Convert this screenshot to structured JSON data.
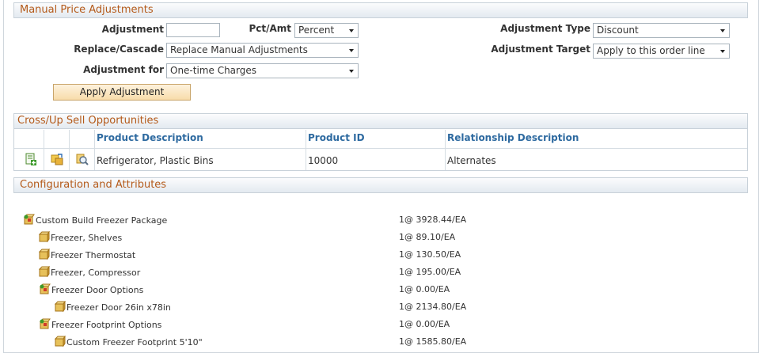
{
  "manual_price": {
    "header": "Manual Price Adjustments",
    "adjustment_label": "Adjustment",
    "adjustment_value": "",
    "pct_amt_label": "Pct/Amt",
    "pct_amt_value": "Percent",
    "adjustment_type_label": "Adjustment Type",
    "adjustment_type_value": "Discount",
    "replace_cascade_label": "Replace/Cascade",
    "replace_cascade_value": "Replace Manual Adjustments",
    "adjustment_target_label": "Adjustment Target",
    "adjustment_target_value": "Apply to this order line",
    "adjustment_for_label": "Adjustment for",
    "adjustment_for_value": "One-time Charges",
    "apply_button": "Apply Adjustment"
  },
  "cross_sell": {
    "header": "Cross/Up Sell Opportunities",
    "columns": [
      "Product Description",
      "Product ID",
      "Relationship Description"
    ],
    "rows": [
      {
        "icons": [
          "add-line-icon",
          "swap-product-icon",
          "search-details-icon"
        ],
        "description": "Refrigerator, Plastic Bins",
        "product_id": "10000",
        "relationship": "Alternates"
      }
    ]
  },
  "configuration": {
    "header": "Configuration and Attributes",
    "items": [
      {
        "label": "Custom Build Freezer Package",
        "qty": "1@ 3928.44/EA",
        "icon": "package-group-icon"
      },
      {
        "label": "Freezer, Shelves",
        "qty": "1@ 89.10/EA",
        "icon": "component-box-icon"
      },
      {
        "label": "Freezer Thermostat",
        "qty": "1@ 130.50/EA",
        "icon": "component-box-icon"
      },
      {
        "label": "Freezer, Compressor",
        "qty": "1@ 195.00/EA",
        "icon": "component-box-icon"
      },
      {
        "label": "Freezer Door Options",
        "qty": "1@ 0.00/EA",
        "icon": "package-group-icon"
      },
      {
        "label": "Freezer Door 26in x78in",
        "qty": "1@ 2134.80/EA",
        "icon": "component-box-icon"
      },
      {
        "label": "Freezer Footprint Options",
        "qty": "1@ 0.00/EA",
        "icon": "package-group-icon"
      },
      {
        "label": "Custom Freezer Footprint 5'10\"",
        "qty": "1@ 1585.80/EA",
        "icon": "component-box-icon"
      }
    ]
  }
}
